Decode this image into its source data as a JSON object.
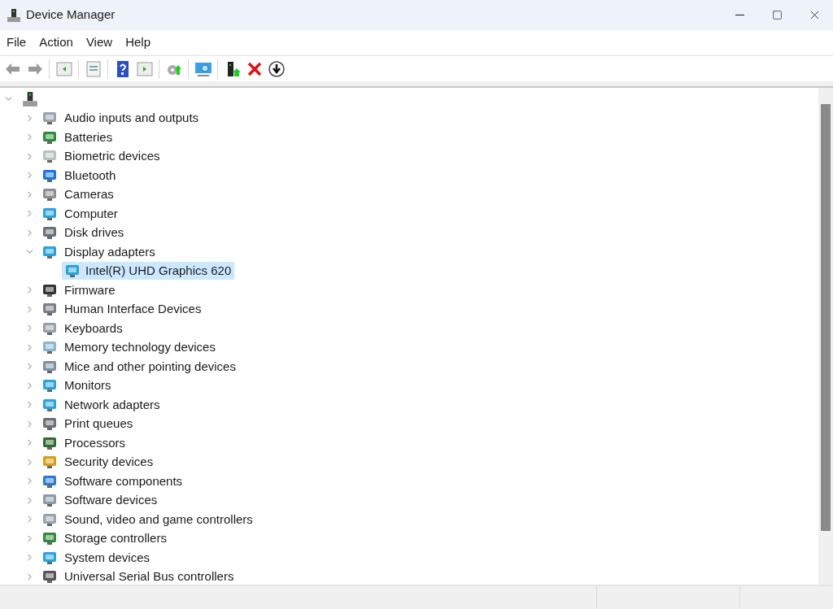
{
  "window": {
    "title": "Device Manager"
  },
  "menu": [
    "File",
    "Action",
    "View",
    "Help"
  ],
  "tree": {
    "expanded": true,
    "children": [
      {
        "label": "Audio inputs and outputs",
        "expanded": false,
        "selected": false
      },
      {
        "label": "Batteries",
        "expanded": false,
        "selected": false
      },
      {
        "label": "Biometric devices",
        "expanded": false,
        "selected": false
      },
      {
        "label": "Bluetooth",
        "expanded": false,
        "selected": false
      },
      {
        "label": "Cameras",
        "expanded": false,
        "selected": false
      },
      {
        "label": "Computer",
        "expanded": false,
        "selected": false
      },
      {
        "label": "Disk drives",
        "expanded": false,
        "selected": false
      },
      {
        "label": "Display adapters",
        "expanded": true,
        "selected": false,
        "children": [
          {
            "label": "Intel(R) UHD Graphics 620",
            "selected": true
          }
        ]
      },
      {
        "label": "Firmware",
        "expanded": false,
        "selected": false
      },
      {
        "label": "Human Interface Devices",
        "expanded": false,
        "selected": false
      },
      {
        "label": "Keyboards",
        "expanded": false,
        "selected": false
      },
      {
        "label": "Memory technology devices",
        "expanded": false,
        "selected": false
      },
      {
        "label": "Mice and other pointing devices",
        "expanded": false,
        "selected": false
      },
      {
        "label": "Monitors",
        "expanded": false,
        "selected": false
      },
      {
        "label": "Network adapters",
        "expanded": false,
        "selected": false
      },
      {
        "label": "Print queues",
        "expanded": false,
        "selected": false
      },
      {
        "label": "Processors",
        "expanded": false,
        "selected": false
      },
      {
        "label": "Security devices",
        "expanded": false,
        "selected": false
      },
      {
        "label": "Software components",
        "expanded": false,
        "selected": false
      },
      {
        "label": "Software devices",
        "expanded": false,
        "selected": false
      },
      {
        "label": "Sound, video and game controllers",
        "expanded": false,
        "selected": false
      },
      {
        "label": "Storage controllers",
        "expanded": false,
        "selected": false
      },
      {
        "label": "System devices",
        "expanded": false,
        "selected": false
      },
      {
        "label": "Universal Serial Bus controllers",
        "expanded": false,
        "selected": false
      }
    ]
  }
}
